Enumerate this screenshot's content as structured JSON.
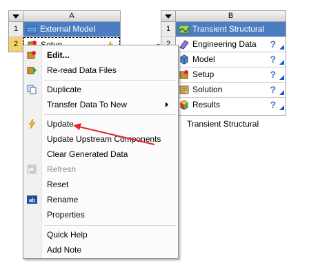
{
  "system_a": {
    "letter": "A",
    "rows": [
      {
        "num": "1",
        "label": "External Model",
        "icon": "external-model-icon"
      },
      {
        "num": "2",
        "label": "Setup",
        "icon": "setup-icon"
      }
    ]
  },
  "system_b": {
    "letter": "B",
    "caption": "Transient Structural",
    "rows": [
      {
        "num": "1",
        "label": "Transient Structural",
        "icon": "transient-structural-icon"
      },
      {
        "num": "2",
        "label": "Engineering Data",
        "icon": "engineering-data-icon",
        "status": "?"
      },
      {
        "num": "",
        "label": "Model",
        "icon": "model-icon",
        "status": "?"
      },
      {
        "num": "",
        "label": "Setup",
        "icon": "setup-icon",
        "status": "?"
      },
      {
        "num": "",
        "label": "Solution",
        "icon": "solution-icon",
        "status": "?"
      },
      {
        "num": "",
        "label": "Results",
        "icon": "results-icon",
        "status": "?"
      }
    ]
  },
  "context_menu": {
    "items": [
      {
        "label": "Edit...",
        "icon": "edit-icon",
        "bold": true
      },
      {
        "label": "Re-read Data Files",
        "icon": "reread-icon"
      },
      {
        "label": "Duplicate",
        "icon": "duplicate-icon"
      },
      {
        "label": "Transfer Data To New",
        "submenu": true
      },
      {
        "label": "Update",
        "icon": "update-lightning-icon"
      },
      {
        "label": "Update Upstream Components"
      },
      {
        "label": "Clear Generated Data"
      },
      {
        "label": "Refresh",
        "icon": "refresh-icon",
        "disabled": true
      },
      {
        "label": "Reset"
      },
      {
        "label": "Rename",
        "icon": "rename-icon"
      },
      {
        "label": "Properties"
      },
      {
        "label": "Quick Help"
      },
      {
        "label": "Add Note"
      }
    ]
  },
  "annotation": {
    "color": "#e0262b"
  },
  "colors": {
    "title_bar": "#4c7dc2",
    "status_blue": "#1656d4"
  }
}
